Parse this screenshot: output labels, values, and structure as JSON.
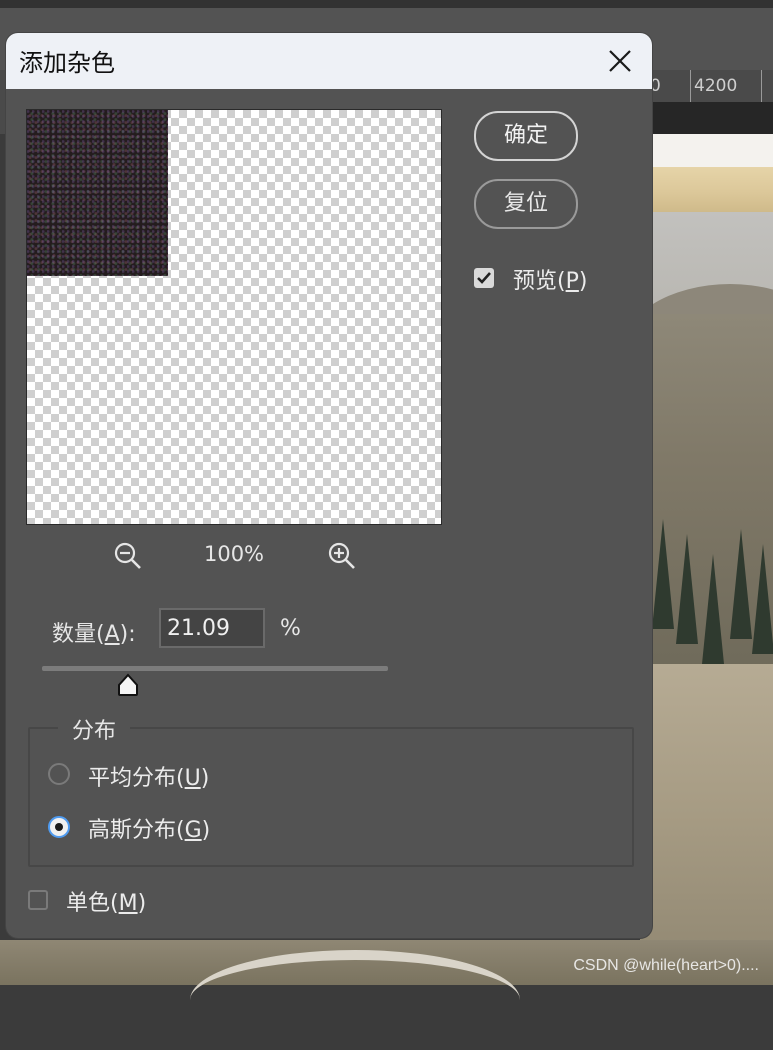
{
  "dialog": {
    "title": "添加杂色",
    "zoom_value": "100%",
    "ok_label": "确定",
    "reset_label": "复位",
    "preview_checkbox": {
      "label_prefix": "预览(",
      "hotkey": "P",
      "label_suffix": ")",
      "checked": true
    },
    "amount": {
      "label_prefix": "数量(",
      "hotkey": "A",
      "label_suffix": "):",
      "value": "21.09",
      "unit": "%",
      "slider_fraction": 0.25
    },
    "distribution": {
      "legend": "分布",
      "options": [
        {
          "label_prefix": "平均分布(",
          "hotkey": "U",
          "label_suffix": ")",
          "selected": false
        },
        {
          "label_prefix": "高斯分布(",
          "hotkey": "G",
          "label_suffix": ")",
          "selected": true
        }
      ]
    },
    "monochrome_checkbox": {
      "label_prefix": "单色(",
      "hotkey": "M",
      "label_suffix": ")",
      "checked": false
    }
  },
  "background": {
    "ruler_labels": [
      "0",
      "4200"
    ],
    "watermark": "CSDN @while(heart>0)...."
  },
  "icons": {
    "close": "close-icon",
    "zoom_out": "zoom-out-icon",
    "zoom_in": "zoom-in-icon",
    "check": "checkmark-icon",
    "slider_thumb": "slider-thumb-icon"
  },
  "colors": {
    "dialog_bg": "#535353",
    "titlebar_bg": "#eef1f6",
    "radio_selected_ring": "#4f9bf0"
  }
}
